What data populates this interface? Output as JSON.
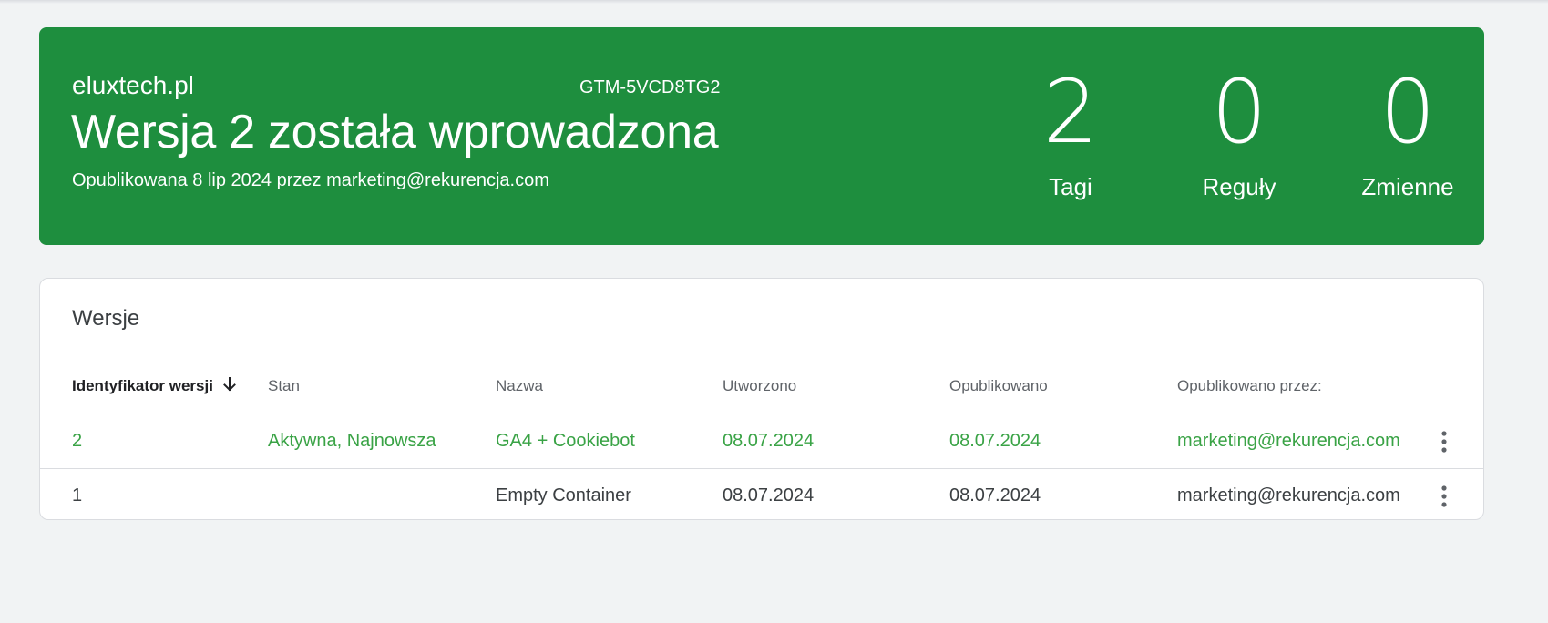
{
  "summary": {
    "container_name": "eluxtech.pl",
    "container_id": "GTM-5VCD8TG2",
    "title": "Wersja 2 została wprowadzona",
    "published_info": "Opublikowana 8 lip 2024 przez marketing@rekurencja.com",
    "stats": {
      "tags": {
        "value": "2",
        "label": "Tagi"
      },
      "rules": {
        "value": "0",
        "label": "Reguły"
      },
      "variables": {
        "value": "0",
        "label": "Zmienne"
      }
    },
    "background_color": "#1e8e3e"
  },
  "versions": {
    "title": "Wersje",
    "columns": {
      "id": "Identyfikator wersji",
      "state": "Stan",
      "name": "Nazwa",
      "created": "Utworzono",
      "published": "Opublikowano",
      "published_by": "Opublikowano przez:"
    },
    "sort_icon": "arrow-down-icon",
    "rows": [
      {
        "id": "2",
        "state": "Aktywna, Najnowsza",
        "name": "GA4 + Cookiebot",
        "created": "08.07.2024",
        "published": "08.07.2024",
        "published_by": "marketing@rekurencja.com",
        "active": true
      },
      {
        "id": "1",
        "state": "",
        "name": "Empty Container",
        "created": "08.07.2024",
        "published": "08.07.2024",
        "published_by": "marketing@rekurencja.com",
        "active": false
      }
    ],
    "row_menu_icon": "more-vert-icon",
    "active_color": "#3aa346"
  }
}
